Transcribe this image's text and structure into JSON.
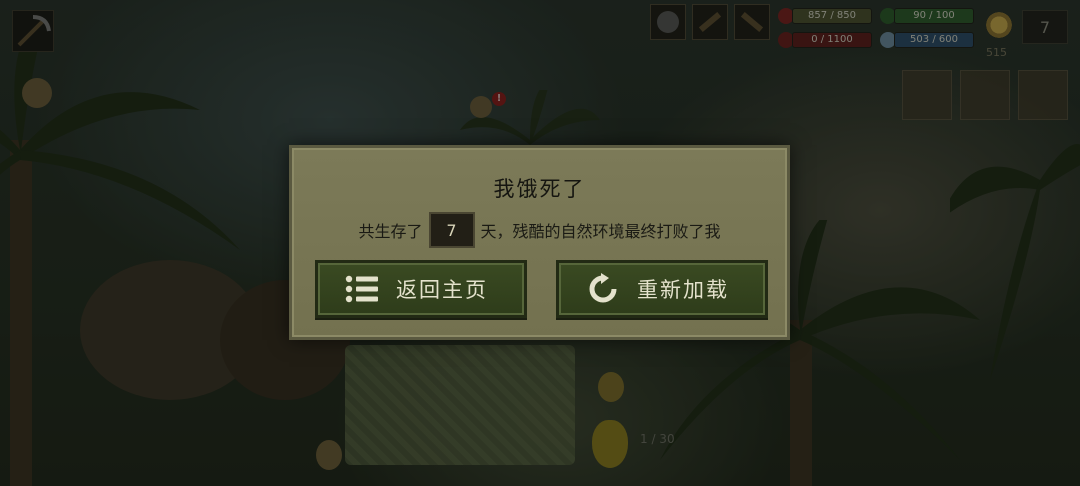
{
  "dialog": {
    "title": "我饿死了",
    "message_prefix": "共生存了",
    "days_survived": "7",
    "message_suffix": "天，残酷的自然环境最终打败了我",
    "buttons": {
      "home_label": "返回主页",
      "reload_label": "重新加载"
    }
  },
  "hud": {
    "health": "857 / 850",
    "food": "90 / 100",
    "water": "503 / 600",
    "energy": "0 / 1100",
    "day_counter": "7",
    "time_label": "515",
    "hunger_fill": 0.0,
    "health_fill": 1.0,
    "food_fill": 0.9,
    "water_fill": 0.84
  },
  "map": {
    "coords": "1 / 30"
  },
  "colors": {
    "dialog_bg": "#7c7a58",
    "button_bg": "#3a4a22",
    "button_text": "#e4e2cc",
    "title_text": "#151510"
  },
  "icons": {
    "home": "list-icon",
    "reload": "refresh-icon",
    "tools": [
      "axe-icon",
      "pickaxe-icon",
      "hammer-icon"
    ]
  }
}
